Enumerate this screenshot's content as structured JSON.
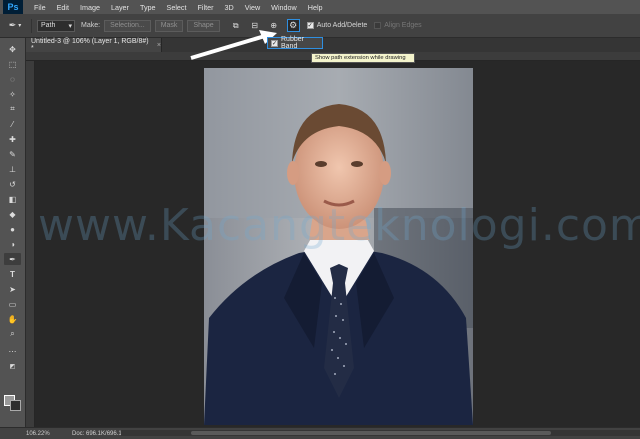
{
  "app": {
    "logo": "Ps"
  },
  "menu": [
    "File",
    "Edit",
    "Image",
    "Layer",
    "Type",
    "Select",
    "Filter",
    "3D",
    "View",
    "Window",
    "Help"
  ],
  "options": {
    "tool_icon": "pen-icon",
    "mode_value": "Path",
    "make_label": "Make:",
    "selection_label": "Selection...",
    "mask_label": "Mask",
    "shape_label": "Shape",
    "auto_add_delete_label": "Auto Add/Delete",
    "auto_add_delete_checked": true,
    "align_edges_label": "Align Edges",
    "align_edges_checked": false
  },
  "rubber_band": {
    "label": "Rubber Band",
    "checked": true
  },
  "tooltip": "Show path extension while drawing",
  "document_tab": {
    "title": "Untitled-3 @ 106% (Layer 1, RGB/8#) *",
    "close": "×"
  },
  "watermark": "www.Kacangteknologi.com",
  "status": {
    "zoom": "106.22%",
    "doc": "Doc: 696.1K/696.1K",
    "arrow": "›"
  },
  "colors": {
    "accent": "#2f8fe0",
    "photo_bg": "#6f7480",
    "suit": "#1b2541"
  }
}
